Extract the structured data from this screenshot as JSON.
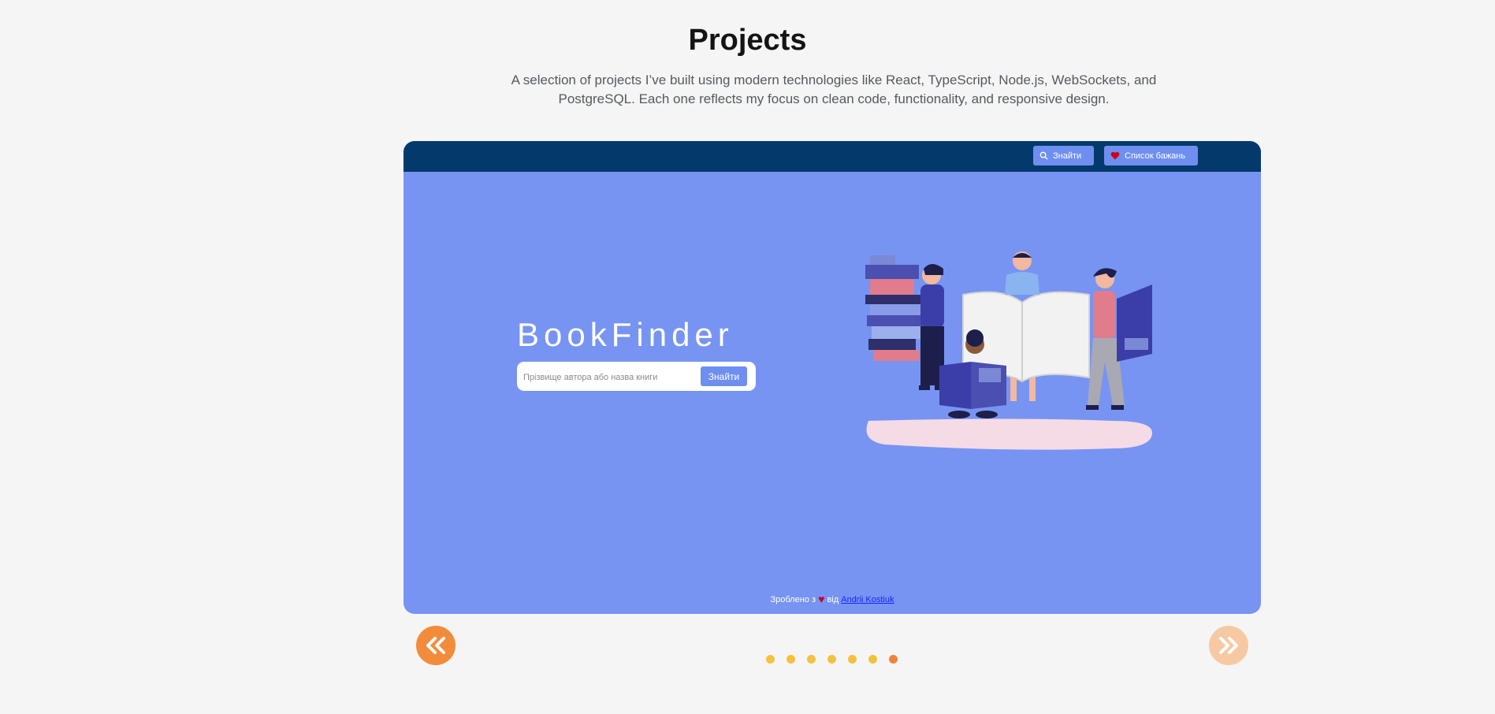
{
  "header": {
    "title": "Projects",
    "subtitle": "A selection of projects I’ve built using modern technologies like React, TypeScript, Node.js, WebSockets, and PostgreSQL. Each one reflects my focus on clean code, functionality, and responsive design."
  },
  "slide": {
    "nav": {
      "search_label": "Знайти",
      "wishlist_label": "Список бажань"
    },
    "brand": "BookFinder",
    "search": {
      "placeholder": "Прізвище автора або назва книги",
      "button_label": "Знайти"
    },
    "footer": {
      "made_with": "Зроблено з",
      "by": "від",
      "author": "Andrii Kostiuk"
    }
  },
  "carousel": {
    "slide_count": 7,
    "active_index": 6
  },
  "colors": {
    "accent_orange": "#f28c3a",
    "dot_yellow": "#f5c13d",
    "slide_bg": "#7794f2",
    "slide_nav": "#043a6b"
  },
  "icons": {
    "prev": "double-chevron-left-icon",
    "next": "double-chevron-right-icon",
    "search": "search-icon",
    "wishlist": "heart-icon"
  }
}
